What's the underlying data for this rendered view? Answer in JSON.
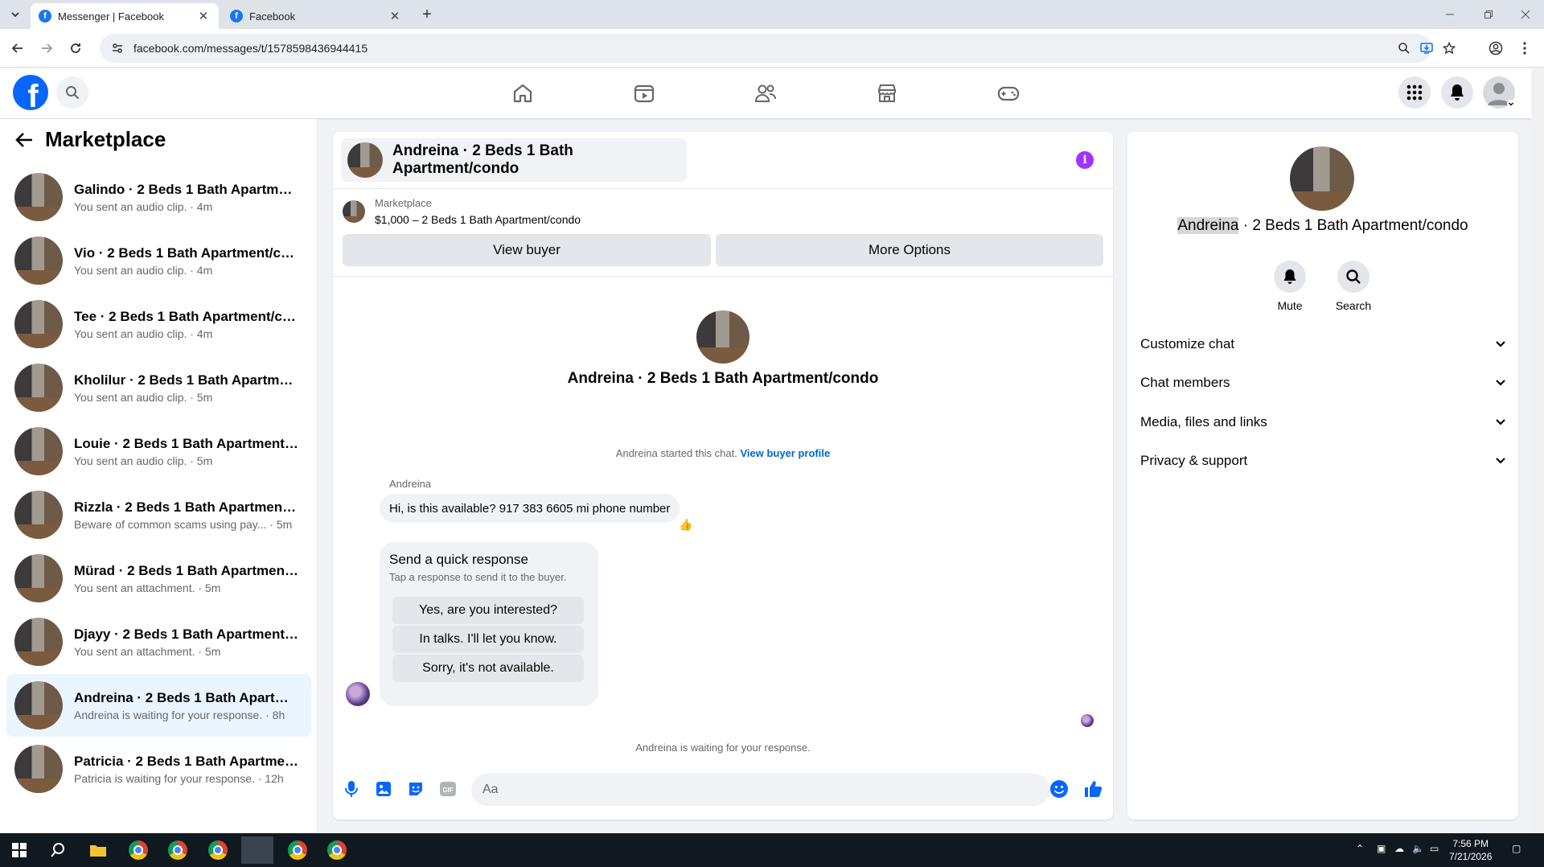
{
  "browser": {
    "tabs": [
      {
        "title": "Messenger | Facebook",
        "active": true
      },
      {
        "title": "Facebook",
        "active": false
      }
    ],
    "url": "facebook.com/messages/t/1578598436944415"
  },
  "fb_header": {
    "logo_letter": "f"
  },
  "left": {
    "title": "Marketplace",
    "conversations": [
      {
        "name": "Galindo · 2 Beds 1 Bath Apartment...",
        "sub": "You sent an audio clip. · 4m"
      },
      {
        "name": "Vio · 2 Beds 1 Bath Apartment/con...",
        "sub": "You sent an audio clip. · 4m"
      },
      {
        "name": "Tee · 2 Beds 1 Bath Apartment/con...",
        "sub": "You sent an audio clip. · 4m"
      },
      {
        "name": "Kholilur · 2 Beds 1 Bath Apartment...",
        "sub": "You sent an audio clip. · 5m"
      },
      {
        "name": "Louie · 2 Beds 1 Bath Apartment/c...",
        "sub": "You sent an audio clip. · 5m"
      },
      {
        "name": "Rizzla · 2 Beds 1 Bath Apartment/c...",
        "sub": "Beware of common scams using pay... · 5m"
      },
      {
        "name": "Mürad · 2 Beds 1 Bath Apartment/...",
        "sub": "You sent an attachment. · 5m"
      },
      {
        "name": "Djayy · 2 Beds 1 Bath Apartment/c...",
        "sub": "You sent an attachment. · 5m"
      },
      {
        "name": "Andreina · 2 Beds 1 Bath Apartme...",
        "sub": "Andreina is waiting for your response. · 8h",
        "active": true
      },
      {
        "name": "Patricia · 2 Beds 1 Bath Apartment...",
        "sub": "Patricia is waiting for your response. · 12h"
      }
    ]
  },
  "chat": {
    "title": "Andreina · 2 Beds 1 Bath Apartment/condo",
    "listing_label": "Marketplace",
    "listing_price": "$1,000 – 2 Beds 1 Bath Apartment/condo",
    "view_buyer": "View buyer",
    "more_options": "More Options",
    "center_name": "Andreina · 2 Beds 1 Bath Apartment/condo",
    "started_text": "Andreina started this chat.",
    "started_link": "View buyer profile",
    "sender": "Andreina",
    "message": "Hi, is this available? 917 383 6605 mi phone number",
    "reaction": "👍",
    "quick_title": "Send a quick response",
    "quick_sub": "Tap a response to send it to the buyer.",
    "quick_replies": [
      "Yes, are you interested?",
      "In talks. I'll let you know.",
      "Sorry, it's not available."
    ],
    "waiting": "Andreina is waiting for your response.",
    "composer_placeholder": "Aa"
  },
  "right": {
    "name_highlight": "Andreina",
    "name_rest": " · 2 Beds 1 Bath Apartment/condo",
    "mute": "Mute",
    "search": "Search",
    "sections": [
      "Customize chat",
      "Chat members",
      "Media, files and links",
      "Privacy & support"
    ]
  },
  "taskbar": {
    "time": "7:56 PM",
    "date": "7/21/2026"
  },
  "colors": {
    "fb_blue": "#0866ff",
    "info_purple": "#a033ff",
    "link": "#0064d1"
  }
}
